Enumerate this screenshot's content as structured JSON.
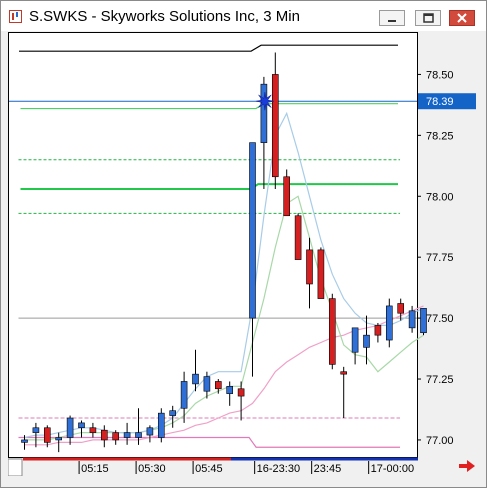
{
  "window": {
    "title": "S.SWKS - Skyworks Solutions Inc, 3 Min",
    "controls": [
      "minimize",
      "restore",
      "close"
    ]
  },
  "price_axis": {
    "ticks": [
      "78.50",
      "78.25",
      "78.00",
      "77.75",
      "77.50",
      "77.25",
      "77.00"
    ],
    "current_price_label": "78.39",
    "current_price_color": "#1464c8"
  },
  "time_axis": {
    "ticks": [
      "05:15",
      "05:30",
      "05:45",
      "16-23:30",
      "23:45",
      "17-00:00"
    ]
  },
  "chart_data": {
    "type": "candlestick",
    "ylim": [
      76.93,
      78.67
    ],
    "last_price": 78.39,
    "candles": [
      {
        "o": 76.99,
        "h": 77.02,
        "l": 76.96,
        "c": 77.0
      },
      {
        "o": 77.03,
        "h": 77.07,
        "l": 76.97,
        "c": 77.05
      },
      {
        "o": 77.05,
        "h": 77.06,
        "l": 76.97,
        "c": 76.99
      },
      {
        "o": 77.0,
        "h": 77.03,
        "l": 76.95,
        "c": 77.01
      },
      {
        "o": 77.01,
        "h": 77.1,
        "l": 76.98,
        "c": 77.09
      },
      {
        "o": 77.05,
        "h": 77.08,
        "l": 77.01,
        "c": 77.07
      },
      {
        "o": 77.05,
        "h": 77.07,
        "l": 77.01,
        "c": 77.03
      },
      {
        "o": 77.04,
        "h": 77.06,
        "l": 76.97,
        "c": 77.0
      },
      {
        "o": 77.03,
        "h": 77.04,
        "l": 76.98,
        "c": 77.0
      },
      {
        "o": 77.01,
        "h": 77.07,
        "l": 76.98,
        "c": 77.03
      },
      {
        "o": 77.01,
        "h": 77.13,
        "l": 76.98,
        "c": 77.03
      },
      {
        "o": 77.02,
        "h": 77.06,
        "l": 76.99,
        "c": 77.05
      },
      {
        "o": 77.01,
        "h": 77.13,
        "l": 76.99,
        "c": 77.11
      },
      {
        "o": 77.1,
        "h": 77.14,
        "l": 77.05,
        "c": 77.12
      },
      {
        "o": 77.13,
        "h": 77.28,
        "l": 77.07,
        "c": 77.24
      },
      {
        "o": 77.23,
        "h": 77.37,
        "l": 77.2,
        "c": 77.27
      },
      {
        "o": 77.2,
        "h": 77.28,
        "l": 77.17,
        "c": 77.26
      },
      {
        "o": 77.24,
        "h": 77.25,
        "l": 77.19,
        "c": 77.21
      },
      {
        "o": 77.19,
        "h": 77.24,
        "l": 77.14,
        "c": 77.22
      },
      {
        "o": 77.21,
        "h": 77.24,
        "l": 77.08,
        "c": 77.18
      },
      {
        "o": 77.5,
        "h": 78.0,
        "l": 77.26,
        "c": 78.22
      },
      {
        "o": 78.22,
        "h": 78.49,
        "l": 78.03,
        "c": 78.46
      },
      {
        "o": 78.5,
        "h": 78.59,
        "l": 78.03,
        "c": 78.08
      },
      {
        "o": 78.08,
        "h": 78.11,
        "l": 77.96,
        "c": 77.92
      },
      {
        "o": 77.92,
        "h": 77.93,
        "l": 77.81,
        "c": 77.74
      },
      {
        "o": 77.78,
        "h": 77.83,
        "l": 77.54,
        "c": 77.64
      },
      {
        "o": 77.78,
        "h": 77.79,
        "l": 77.62,
        "c": 77.58
      },
      {
        "o": 77.58,
        "h": 77.6,
        "l": 77.29,
        "c": 77.31
      },
      {
        "o": 77.28,
        "h": 77.3,
        "l": 77.09,
        "c": 77.27
      },
      {
        "o": 77.36,
        "h": 77.45,
        "l": 77.31,
        "c": 77.46
      },
      {
        "o": 77.38,
        "h": 77.51,
        "l": 77.31,
        "c": 77.43
      },
      {
        "o": 77.47,
        "h": 77.48,
        "l": 77.4,
        "c": 77.43
      },
      {
        "o": 77.41,
        "h": 77.58,
        "l": 77.38,
        "c": 77.55
      },
      {
        "o": 77.56,
        "h": 77.58,
        "l": 77.49,
        "c": 77.52
      },
      {
        "o": 77.46,
        "h": 77.55,
        "l": 77.44,
        "c": 77.53
      },
      {
        "o": 77.44,
        "h": 77.54,
        "l": 77.43,
        "c": 77.54
      }
    ],
    "overlays": {
      "dark_green_line": {
        "color": "#22c84a",
        "start_value": 78.03,
        "end_value": 78.05
      },
      "green_upper": {
        "color": "#4cd264",
        "start_value": 78.36,
        "end_value": 78.38
      },
      "green_dashed_levels": [
        78.15,
        77.93
      ],
      "black_reference_top": 78.62,
      "pink_dashed_level": 77.09,
      "pink_bottom_line": [
        77.01,
        76.97
      ],
      "gray_reference": 77.5
    },
    "lines": {
      "light_blue": [
        77.01,
        77.02,
        77.02,
        77.03,
        77.04,
        77.05,
        77.05,
        77.04,
        77.03,
        77.03,
        77.03,
        77.04,
        77.06,
        77.09,
        77.15,
        77.21,
        77.26,
        77.28,
        77.28,
        77.28,
        77.55,
        77.92,
        78.25,
        78.34,
        78.18,
        78.0,
        77.82,
        77.68,
        77.58,
        77.52,
        77.48,
        77.47,
        77.47,
        77.49,
        77.52,
        77.54
      ],
      "light_green": [
        77.0,
        77.0,
        77.0,
        77.01,
        77.02,
        77.03,
        77.03,
        77.03,
        77.03,
        77.03,
        77.03,
        77.04,
        77.05,
        77.07,
        77.1,
        77.15,
        77.18,
        77.2,
        77.22,
        77.22,
        77.4,
        77.58,
        77.79,
        77.97,
        78.0,
        77.83,
        77.66,
        77.53,
        77.39,
        77.35,
        77.34,
        77.28,
        77.32,
        77.36,
        77.4,
        77.43
      ],
      "pink": [
        76.98,
        76.98,
        76.98,
        76.99,
        76.99,
        76.99,
        77.0,
        77.0,
        77.0,
        77.0,
        77.0,
        77.01,
        77.02,
        77.03,
        77.04,
        77.06,
        77.07,
        77.09,
        77.11,
        77.12,
        77.15,
        77.21,
        77.28,
        77.32,
        77.35,
        77.38,
        77.4,
        77.42,
        77.43,
        77.45,
        77.46,
        77.47,
        77.49,
        77.51,
        77.53,
        77.55
      ]
    }
  }
}
